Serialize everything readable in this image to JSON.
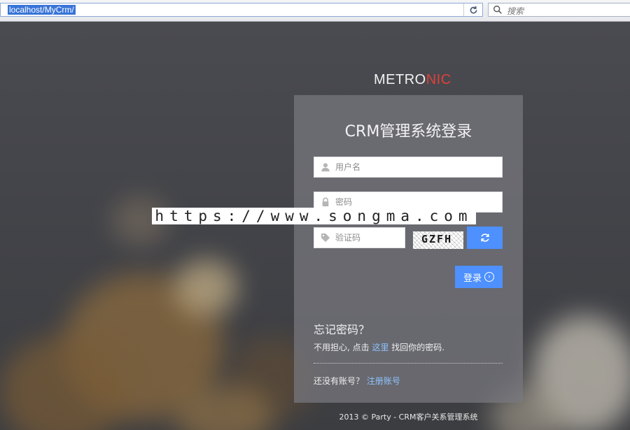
{
  "browser": {
    "address": "localhost/MyCrm/",
    "search_placeholder": "搜索"
  },
  "logo": {
    "part1": "METRO",
    "part2": "NIC",
    "accent_color": "#e0403a"
  },
  "login": {
    "title": "CRM管理系统登录",
    "username_placeholder": "用户名",
    "password_placeholder": "密码",
    "captcha_placeholder": "验证码",
    "captcha_text": "GZFH",
    "login_label": "登录",
    "button_color": "#4d90fe"
  },
  "forgot": {
    "title": "忘记密码？",
    "text_before": "不用担心, 点击 ",
    "link": "这里",
    "text_after": " 找回你的密码."
  },
  "register": {
    "prompt": "还没有账号？ ",
    "link": "注册账号"
  },
  "footer": "2013 © Party - CRM客户关系管理系统",
  "watermark": "https://www.songma.com"
}
